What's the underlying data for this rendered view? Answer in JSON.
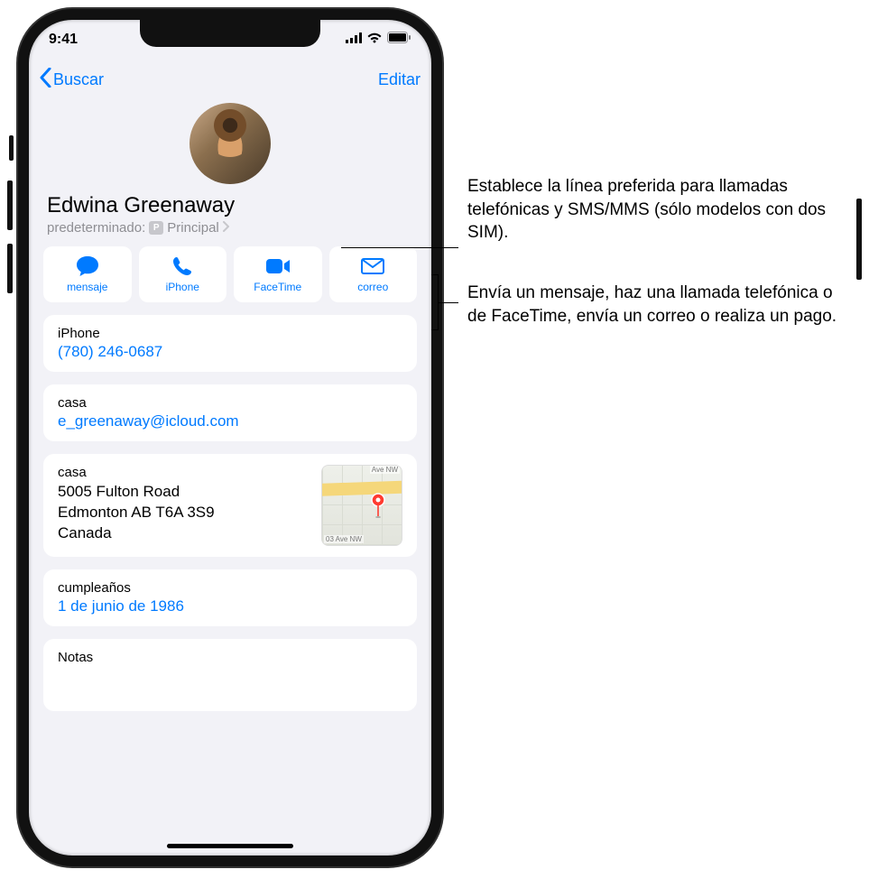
{
  "statusbar": {
    "time": "9:41"
  },
  "nav": {
    "back": "Buscar",
    "edit": "Editar"
  },
  "contact": {
    "name": "Edwina Greenaway",
    "default_label": "predeterminado:",
    "sim_badge": "P",
    "sim_name": "Principal"
  },
  "actions": {
    "message": "mensaje",
    "call": "iPhone",
    "facetime": "FaceTime",
    "mail": "correo"
  },
  "phone": {
    "label": "iPhone",
    "value": "(780) 246-0687"
  },
  "email": {
    "label": "casa",
    "value": "e_greenaway@icloud.com"
  },
  "address": {
    "label": "casa",
    "line1": "5005 Fulton Road",
    "line2": "Edmonton AB T6A 3S9",
    "line3": "Canada",
    "map_lbl1": "Ave NW",
    "map_lbl2": "03 Ave NW"
  },
  "birthday": {
    "label": "cumpleaños",
    "value": "1 de junio de 1986"
  },
  "notes": {
    "label": "Notas"
  },
  "callouts": {
    "c1": "Establece la línea preferida para llamadas telefónicas y SMS/MMS (sólo modelos con dos SIM).",
    "c2": "Envía un mensaje, haz una llamada telefónica o de FaceTime, envía un correo o realiza un pago."
  }
}
